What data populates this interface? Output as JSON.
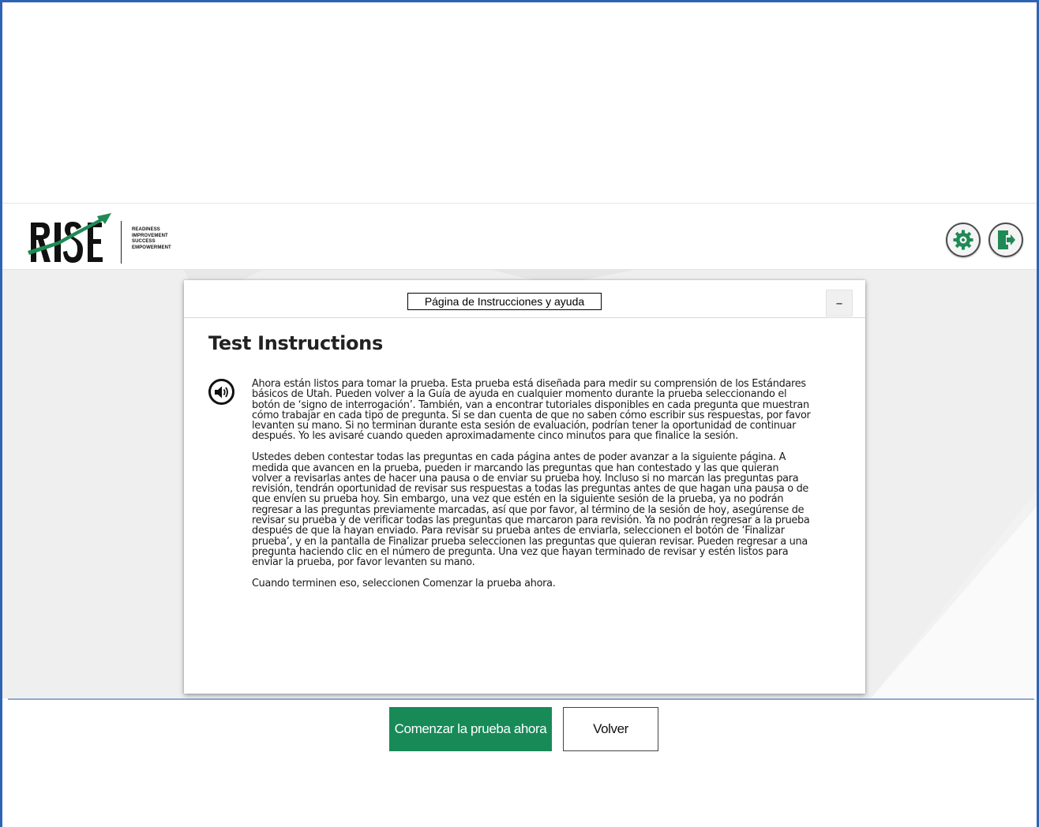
{
  "header": {
    "logo_text": "RISE",
    "logo_tagline": [
      "READINESS",
      "IMPROVEMENT",
      "SUCCESS",
      "EMPOWERMENT"
    ],
    "settings_icon": "gear-icon",
    "logout_icon": "exit-door-icon"
  },
  "dialog": {
    "title": "Página de Instrucciones y ayuda",
    "minimize_label": "–",
    "heading": "Test Instructions",
    "speaker_icon": "speaker-icon",
    "paragraphs": [
      "Ahora están listos para tomar la prueba. Esta prueba está diseñada para medir su comprensión de los Estándares básicos de Utah. Pueden volver a la Guía de ayuda en cualquier momento durante la prueba seleccionando el botón de ‘signo de interrogación’. También, van a encontrar tutoriales disponibles en cada pregunta que muestran cómo trabajar en cada tipo de pregunta. Si se dan cuenta de que no saben cómo escribir sus respuestas, por favor levanten su mano. Si no terminan durante esta sesión de evaluación, podrían tener la oportunidad de continuar después. Yo les avisaré cuando queden aproximadamente cinco minutos para que finalice la sesión.",
      "Ustedes deben contestar todas las preguntas en cada página antes de poder avanzar a la siguiente página. A medida que avancen en la prueba, pueden ir marcando las preguntas que han contestado y las que quieran volver a revisarlas antes de hacer una pausa o de enviar su prueba hoy. Incluso si no marcan las preguntas para revisión, tendrán oportunidad de revisar sus respuestas a todas las preguntas antes de que hagan una pausa o de que envíen su prueba hoy. Sin embargo, una vez que estén en la siguiente sesión de la prueba, ya no podrán regresar a las preguntas previamente marcadas, así que por favor, al término de la sesión de hoy, asegúrense de revisar su prueba y de verificar todas las preguntas que marcaron para revisión. Ya no podrán regresar a la prueba después de que la hayan enviado. Para revisar su prueba antes de enviarla, seleccionen el botón de ‘Finalizar prueba’, y en la pantalla de Finalizar prueba seleccionen las preguntas que quieran revisar. Pueden regresar a una pregunta haciendo clic en el número de pregunta. Una vez que hayan terminado de revisar y estén listos para enviar la prueba, por favor levanten su mano.",
      "Cuando terminen eso, seleccionen Comenzar la prueba ahora."
    ]
  },
  "footer": {
    "start_label": "Comenzar la prueba ahora",
    "back_label": "Volver"
  },
  "colors": {
    "frame_border": "#2e64b4",
    "start_button": "#178a57",
    "logo_arrow": "#1f8a55",
    "main_background": "#f2f2f2"
  }
}
